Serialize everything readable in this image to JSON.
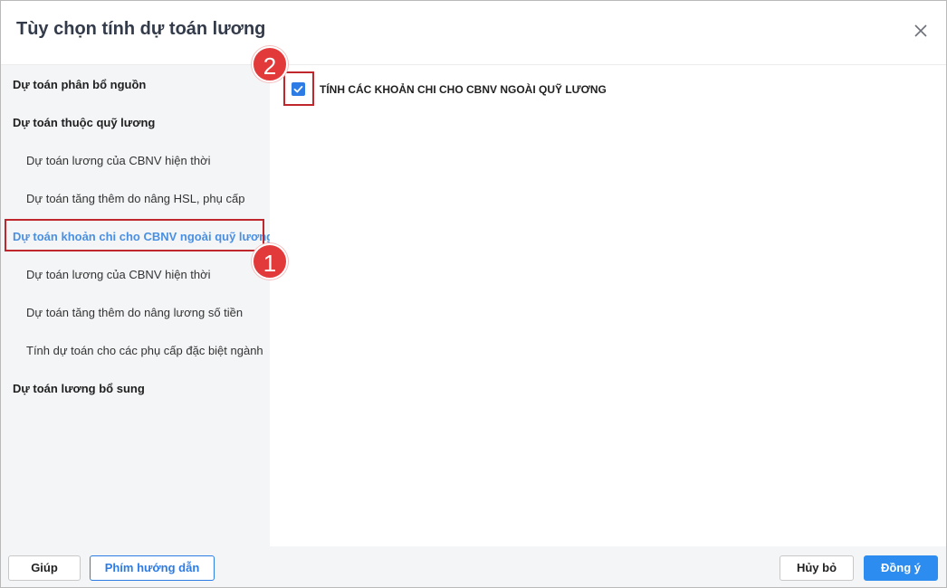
{
  "dialog": {
    "title": "Tùy chọn tính dự toán lương"
  },
  "sidebar": {
    "items": [
      {
        "label": "Dự toán phân bổ nguồn",
        "level": 1,
        "active": false
      },
      {
        "label": "Dự toán thuộc quỹ lương",
        "level": 1,
        "active": false
      },
      {
        "label": "Dự toán lương của CBNV hiện thời",
        "level": 2,
        "active": false
      },
      {
        "label": "Dự toán tăng thêm do nâng HSL, phụ cấp",
        "level": 2,
        "active": false
      },
      {
        "label": "Dự toán khoản chi cho CBNV ngoài quỹ lương",
        "level": 1,
        "active": true
      },
      {
        "label": "Dự toán lương của CBNV hiện thời",
        "level": 2,
        "active": false
      },
      {
        "label": "Dự toán tăng thêm do nâng lương số tiền",
        "level": 2,
        "active": false
      },
      {
        "label": "Tính dự toán cho các phụ cấp đặc biệt ngành",
        "level": 2,
        "active": false
      },
      {
        "label": "Dự toán lương bổ sung",
        "level": 1,
        "active": false
      }
    ]
  },
  "main": {
    "checkbox": {
      "label": "TÍNH CÁC KHOẢN CHI CHO CBNV NGOÀI QUỸ LƯƠNG",
      "checked": true
    }
  },
  "annotations": {
    "badge_1": "1",
    "badge_2": "2"
  },
  "footer": {
    "help_label": "Giúp",
    "shortcut_label": "Phím hướng dẫn",
    "cancel_label": "Hủy bỏ",
    "ok_label": "Đồng ý"
  },
  "colors": {
    "accent": "#2d7ce5",
    "highlight": "#c0272d",
    "badge": "#e2393b",
    "sidebar_bg": "#f4f5f7"
  }
}
